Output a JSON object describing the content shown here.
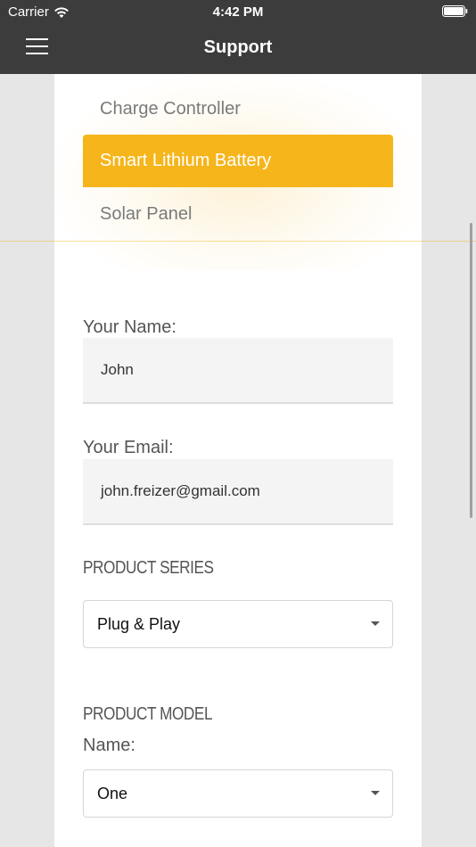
{
  "status_bar": {
    "carrier": "Carrier",
    "time": "4:42 PM"
  },
  "header": {
    "title": "Support"
  },
  "picker": {
    "items": [
      {
        "label": "Charge Controller"
      },
      {
        "label": "Smart Lithium Battery"
      },
      {
        "label": "Solar Panel"
      }
    ],
    "selected_index": 1
  },
  "form": {
    "name_label": "Your Name:",
    "name_value": "John",
    "email_label": "Your Email:",
    "email_value": "john.freizer@gmail.com",
    "product_series_heading": "PRODUCT SERIES",
    "product_series_value": "Plug & Play",
    "product_model_heading": "PRODUCT MODEL",
    "model_name_label": "Name:",
    "model_name_value": "One"
  },
  "colors": {
    "accent": "#f5b51b",
    "header_bg": "#3c3c3c",
    "page_bg": "#e6e6e6",
    "card_bg": "#ffffff",
    "field_bg": "#f4f4f4"
  },
  "icons": {
    "menu": "hamburger-menu-icon",
    "wifi": "wifi-icon",
    "battery": "battery-icon",
    "dropdown": "chevron-down-icon"
  }
}
